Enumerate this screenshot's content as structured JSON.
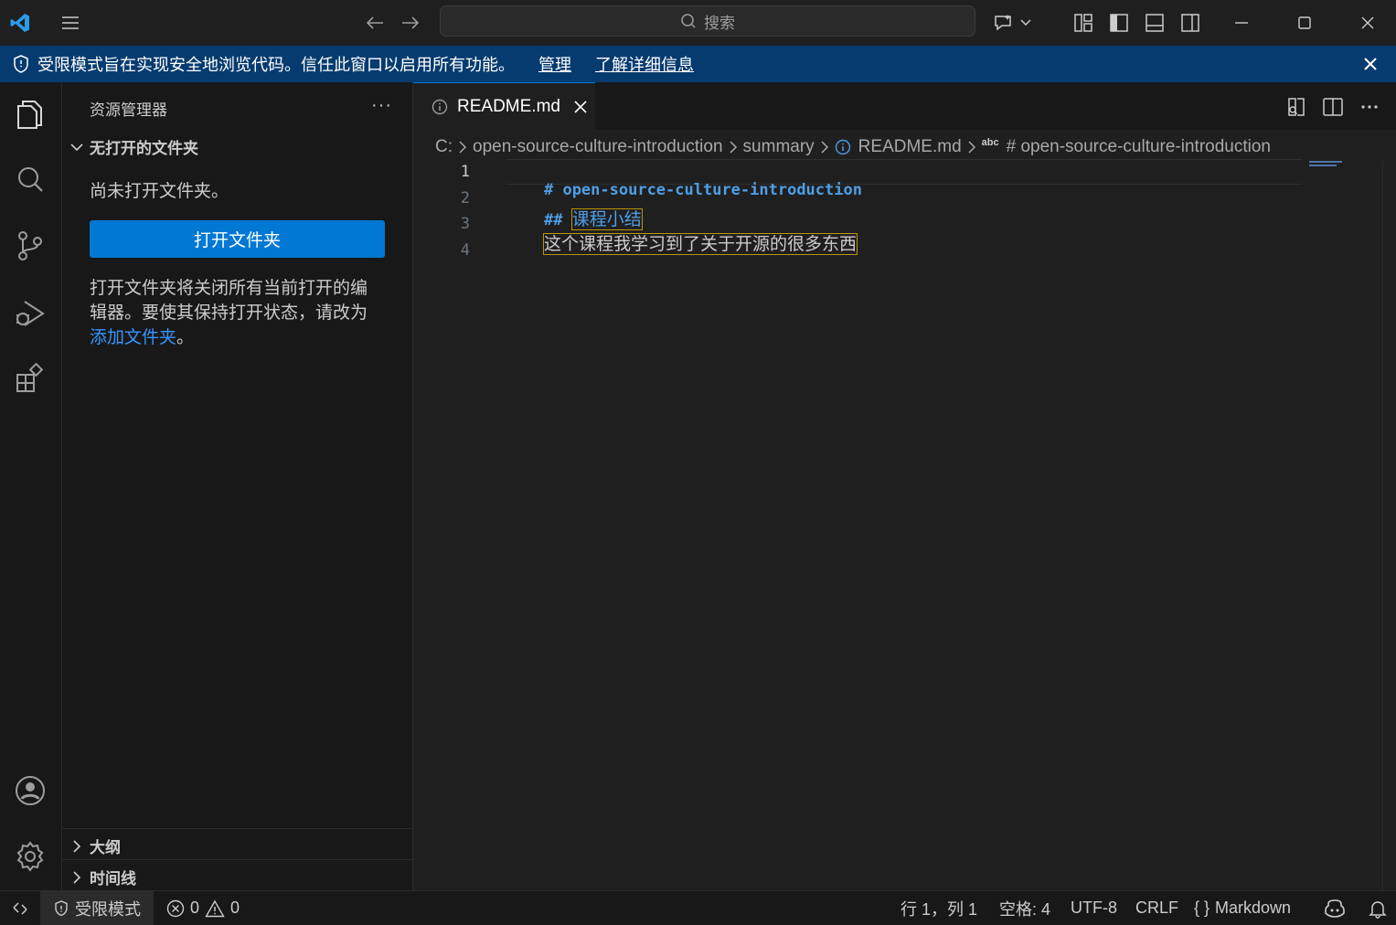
{
  "titlebar": {
    "search_placeholder": "搜索"
  },
  "banner": {
    "message": "受限模式旨在实现安全地浏览代码。信任此窗口以启用所有功能。",
    "manage_link": "管理",
    "learn_more_link": "了解详细信息"
  },
  "sidebar": {
    "title": "资源管理器",
    "more": "···",
    "no_folder_section": "无打开的文件夹",
    "no_folder_text": "尚未打开文件夹。",
    "open_folder_button": "打开文件夹",
    "info_line1": "打开文件夹将关闭所有当前打开的编",
    "info_line2": "辑器。要使其保持打开状态，请改为",
    "add_folder_link": "添加文件夹",
    "add_folder_suffix": "。",
    "outline_section": "大纲",
    "timeline_section": "时间线"
  },
  "editor": {
    "tab_label": "README.md",
    "breadcrumb": {
      "drive": "C:",
      "folder": "open-source-culture-introduction",
      "subfolder": "summary",
      "file": "README.md",
      "symbol_prefix": "abc",
      "symbol": "# open-source-culture-introduction"
    },
    "lines": [
      {
        "num": "1",
        "marker": "#",
        "text": "open-source-culture-introduction"
      },
      {
        "num": "2",
        "marker": "##",
        "text": "课程小结"
      },
      {
        "num": "3",
        "text": "这个课程我学习到了关于开源的很多东西"
      },
      {
        "num": "4",
        "text": ""
      }
    ]
  },
  "statusbar": {
    "restricted_mode": "受限模式",
    "errors": "0",
    "warnings": "0",
    "position": "行 1，列 1",
    "spaces": "空格: 4",
    "encoding": "UTF-8",
    "eol": "CRLF",
    "language_icon": "{ }",
    "language": "Markdown"
  },
  "colors": {
    "accent": "#0078d4",
    "banner_bg": "#063b6f",
    "heading_text": "#4f9ee6",
    "link": "#3794ff"
  }
}
